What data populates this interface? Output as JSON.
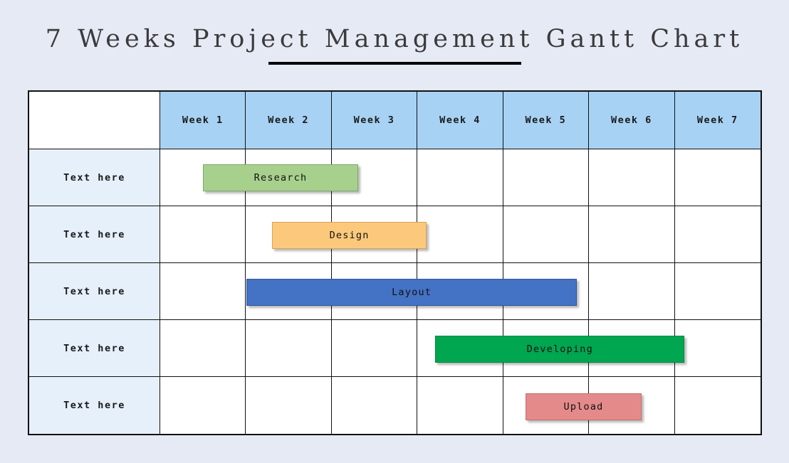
{
  "page": {
    "background_color": "#E6EAF5",
    "title": "7 Weeks Project Management Gantt Chart"
  },
  "table": {
    "corner_header": "",
    "week_headers": [
      "Week 1",
      "Week 2",
      "Week 3",
      "Week 4",
      "Week 5",
      "Week 6",
      "Week 7"
    ],
    "header_bg": "#A7D2F4",
    "row_label_bg": "#E6F0FB",
    "row_labels": [
      "Text here",
      "Text here",
      "Text here",
      "Text here",
      "Text here"
    ]
  },
  "chart_data": {
    "type": "bar",
    "subtype": "gantt",
    "title": "7 Weeks Project Management Gantt Chart",
    "xlabel": "",
    "ylabel": "",
    "categories": [
      "Week 1",
      "Week 2",
      "Week 3",
      "Week 4",
      "Week 5",
      "Week 6",
      "Week 7"
    ],
    "xlim": [
      0,
      7
    ],
    "grid": true,
    "legend": "none",
    "tasks": [
      {
        "row": 1,
        "row_label": "Text here",
        "label": "Research",
        "start_week": 0.5,
        "end_week": 2.3,
        "duration_weeks": 1.8,
        "fill_color": "#A8D08D",
        "border_color": "#7FA86A",
        "text_color": "#111111"
      },
      {
        "row": 2,
        "row_label": "Text here",
        "label": "Design",
        "start_week": 1.3,
        "end_week": 3.1,
        "duration_weeks": 1.8,
        "fill_color": "#FCC97C",
        "border_color": "#D9A355",
        "text_color": "#111111"
      },
      {
        "row": 3,
        "row_label": "Text here",
        "label": "Layout",
        "start_week": 1.0,
        "end_week": 4.85,
        "duration_weeks": 3.85,
        "fill_color": "#4472C4",
        "border_color": "#2F5597",
        "text_color": "#111111"
      },
      {
        "row": 4,
        "row_label": "Text here",
        "label": "Developing",
        "start_week": 3.2,
        "end_week": 6.1,
        "duration_weeks": 2.9,
        "fill_color": "#00A650",
        "border_color": "#00853F",
        "text_color": "#111111"
      },
      {
        "row": 5,
        "row_label": "Text here",
        "label": "Upload",
        "start_week": 4.25,
        "end_week": 5.6,
        "duration_weeks": 1.35,
        "fill_color": "#E58A8A",
        "border_color": "#C46E6E",
        "text_color": "#111111"
      }
    ]
  }
}
